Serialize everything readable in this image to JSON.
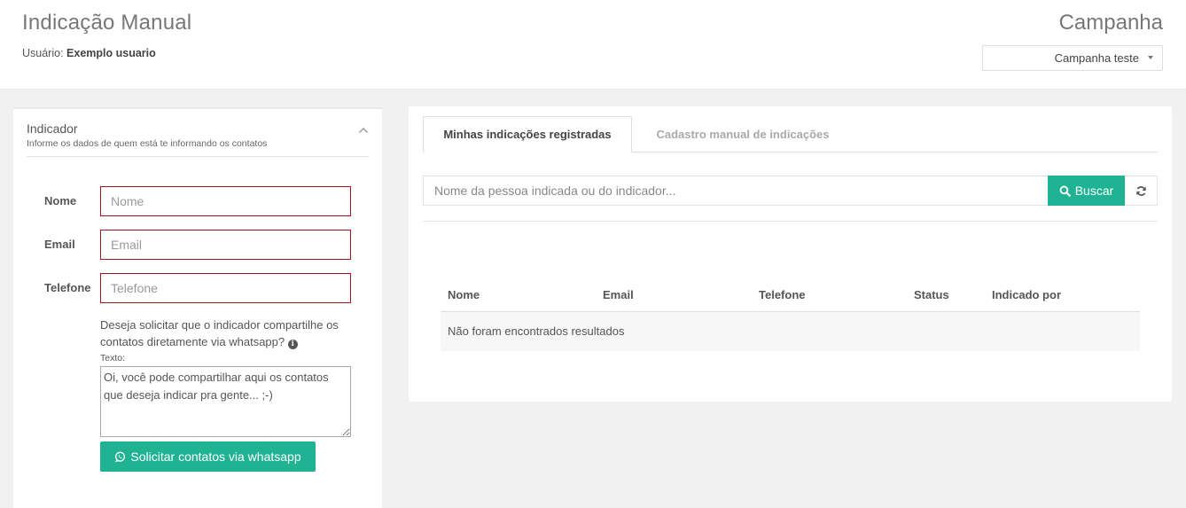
{
  "header": {
    "title": "Indicação Manual",
    "user_label": "Usuário:",
    "user_name": "Exemplo usuario",
    "campaign_title": "Campanha",
    "campaign_selected": "Campanha teste"
  },
  "indicator_panel": {
    "title": "Indicador",
    "subtitle": "Informe os dados de quem está te informando os contatos",
    "fields": {
      "nome_label": "Nome",
      "nome_placeholder": "Nome",
      "email_label": "Email",
      "email_placeholder": "Email",
      "telefone_label": "Telefone",
      "telefone_placeholder": "Telefone"
    },
    "share_question": "Deseja solicitar que o indicador compartilhe os contatos diretamente via whatsapp?",
    "texto_label": "Texto:",
    "texto_value": "Oi, você pode compartilhar aqui os contatos que deseja indicar pra gente... ;-)",
    "whatsapp_button": "Solicitar contatos via whatsapp"
  },
  "main_panel": {
    "tabs": [
      {
        "label": "Minhas indicações registradas",
        "active": true
      },
      {
        "label": "Cadastro manual de indicações",
        "active": false
      }
    ],
    "search_placeholder": "Nome da pessoa indicada ou do indicador...",
    "search_button": "Buscar",
    "table": {
      "columns": [
        "Nome",
        "Email",
        "Telefone",
        "Status",
        "Indicado por"
      ],
      "empty_message": "Não foram encontrados resultados"
    }
  },
  "colors": {
    "accent": "#1fb393",
    "invalid_border": "#a3131b"
  }
}
